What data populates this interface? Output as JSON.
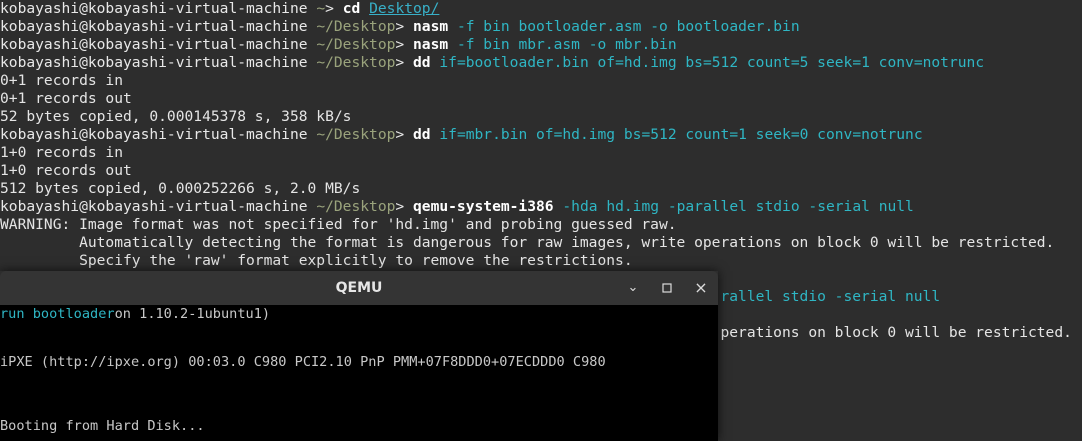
{
  "terminal": {
    "lines": [
      {
        "user": "kobayashi@kobayashi-virtual-machine",
        "path": "~",
        "sep": ">",
        "cmd": "cd",
        "arg": "Desktop/"
      },
      {
        "user": "kobayashi@kobayashi-virtual-machine",
        "path": "~/Desktop",
        "sep": ">",
        "cmd": "nasm",
        "arg": "-f bin bootloader.asm -o bootloader.bin"
      },
      {
        "user": "kobayashi@kobayashi-virtual-machine",
        "path": "~/Desktop",
        "sep": ">",
        "cmd": "nasm",
        "arg": "-f bin mbr.asm -o mbr.bin"
      },
      {
        "user": "kobayashi@kobayashi-virtual-machine",
        "path": "~/Desktop",
        "sep": ">",
        "cmd": "dd",
        "arg": "if=bootloader.bin of=hd.img bs=512 count=5 seek=1 conv=notrunc"
      },
      {
        "out": "0+1 records in"
      },
      {
        "out": "0+1 records out"
      },
      {
        "out": "52 bytes copied, 0.000145378 s, 358 kB/s"
      },
      {
        "user": "kobayashi@kobayashi-virtual-machine",
        "path": "~/Desktop",
        "sep": ">",
        "cmd": "dd",
        "arg": "if=mbr.bin of=hd.img bs=512 count=1 seek=0 conv=notrunc"
      },
      {
        "out": "1+0 records in"
      },
      {
        "out": "1+0 records out"
      },
      {
        "out": "512 bytes copied, 0.000252266 s, 2.0 MB/s"
      },
      {
        "user": "kobayashi@kobayashi-virtual-machine",
        "path": "~/Desktop",
        "sep": ">",
        "cmd": "qemu-system-i386",
        "arg": "-hda hd.img -parallel stdio -serial null"
      },
      {
        "out": "WARNING: Image format was not specified for 'hd.img' and probing guessed raw."
      },
      {
        "out": "         Automatically detecting the format is dangerous for raw images, write operations on block 0 will be restricted."
      },
      {
        "out": "         Specify the 'raw' format explicitly to remove the restrictions."
      },
      {
        "out": ""
      },
      {
        "out": "                                                                                  rallel stdio -serial null",
        "cyan": true
      },
      {
        "out": ""
      },
      {
        "out": "                                                                                  perations on block 0 will be restricted."
      }
    ]
  },
  "qemu": {
    "title": "QEMU",
    "minimize": "⌄",
    "maximize": "▫",
    "close": "×",
    "screen": {
      "line1_prefix": "run bootloader",
      "line1_rest": "on 1.10.2-1ubuntu1)",
      "line2": "iPXE (http://ipxe.org) 00:03.0 C980 PCI2.10 PnP PMM+07F8DDD0+07ECDDD0 C980",
      "line3": "Booting from Hard Disk..."
    }
  }
}
